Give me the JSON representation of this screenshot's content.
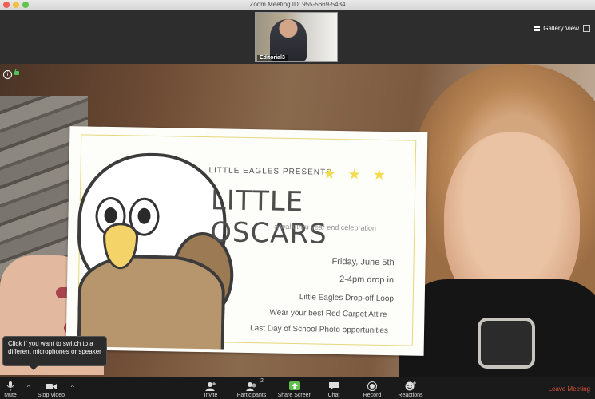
{
  "window": {
    "title": "Zoom Meeting ID: 955-5669-5434"
  },
  "strip": {
    "thumbnail_label": "Editorial3",
    "gallery_view_label": "Gallery View"
  },
  "card": {
    "presents": "LITTLE EAGLES PRESENTS",
    "stars": "★ ★ ★",
    "title": "LITTLE OSCARS",
    "subtitle": "a walk thru year end celebration",
    "date": "Friday, June 5th",
    "time": "2-4pm  drop in",
    "location": "Little Eagles Drop-off Loop",
    "attire": "Wear your best Red Carpet Attire",
    "photo": "Last Day of School Photo opportunities"
  },
  "tooltip": {
    "text": "Click if you want to switch to a different microphones or speaker"
  },
  "toolbar": {
    "mute": "Mute",
    "stop_video": "Stop Video",
    "invite": "Invite",
    "participants": "Participants",
    "participants_count": "2",
    "share_screen": "Share Screen",
    "chat": "Chat",
    "record": "Record",
    "reactions": "Reactions",
    "leave": "Leave Meeting"
  },
  "colors": {
    "leave": "#e0533f",
    "share": "#5fbf4a",
    "accent_star": "#f2dc4e"
  },
  "icons": [
    "info-icon",
    "lock-icon",
    "grid-icon",
    "fullscreen-icon",
    "microphone-icon",
    "video-camera-icon",
    "add-person-icon",
    "participants-icon",
    "share-screen-icon",
    "chat-icon",
    "record-icon",
    "reactions-icon"
  ]
}
